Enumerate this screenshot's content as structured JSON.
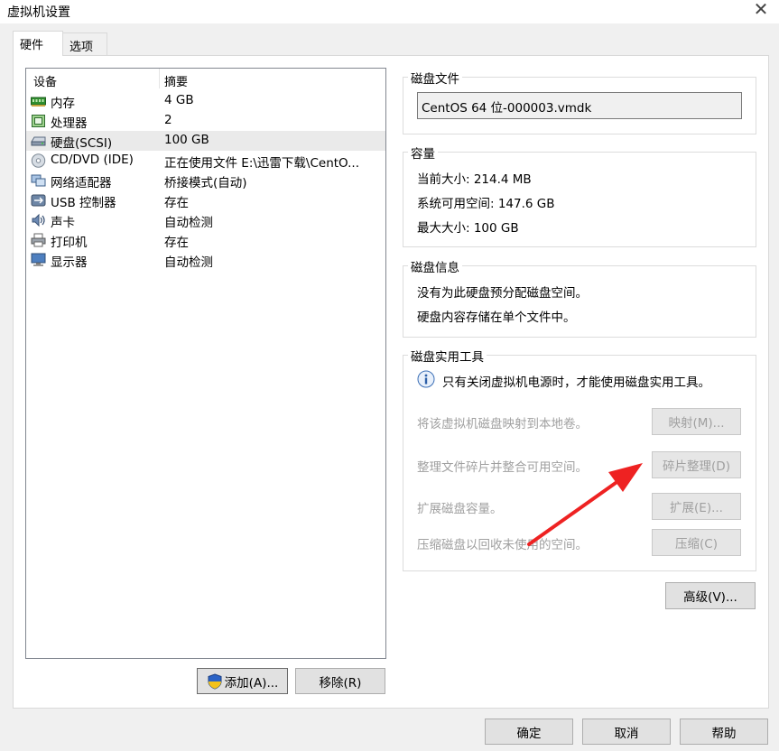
{
  "window": {
    "title": "虚拟机设置"
  },
  "tabs": [
    {
      "label": "硬件"
    },
    {
      "label": "选项"
    }
  ],
  "device_list": {
    "headers": {
      "device": "设备",
      "summary": "摘要"
    },
    "rows": [
      {
        "name": "内存",
        "summary": "4 GB",
        "icon": "memory-icon"
      },
      {
        "name": "处理器",
        "summary": "2",
        "icon": "processor-icon"
      },
      {
        "name": "硬盘(SCSI)",
        "summary": "100 GB",
        "icon": "hard-disk-icon"
      },
      {
        "name": "CD/DVD (IDE)",
        "summary": "正在使用文件 E:\\迅雷下载\\CentO...",
        "icon": "cd-dvd-icon"
      },
      {
        "name": "网络适配器",
        "summary": "桥接模式(自动)",
        "icon": "network-adapter-icon"
      },
      {
        "name": "USB 控制器",
        "summary": "存在",
        "icon": "usb-icon"
      },
      {
        "name": "声卡",
        "summary": "自动检测",
        "icon": "sound-card-icon"
      },
      {
        "name": "打印机",
        "summary": "存在",
        "icon": "printer-icon"
      },
      {
        "name": "显示器",
        "summary": "自动检测",
        "icon": "display-icon"
      }
    ],
    "selected_index": 2
  },
  "buttons": {
    "add": "添加(A)...",
    "remove": "移除(R)",
    "ok": "确定",
    "cancel": "取消",
    "help": "帮助",
    "advanced": "高级(V)..."
  },
  "disk_file": {
    "title": "磁盘文件",
    "value": "CentOS 64 位-000003.vmdk"
  },
  "capacity": {
    "title": "容量",
    "current_size": "当前大小: 214.4 MB",
    "free_space": "系统可用空间: 147.6 GB",
    "max_size": "最大大小: 100 GB"
  },
  "disk_info": {
    "title": "磁盘信息",
    "line1": "没有为此硬盘预分配磁盘空间。",
    "line2": "硬盘内容存储在单个文件中。"
  },
  "disk_utilities": {
    "title": "磁盘实用工具",
    "notice": "只有关闭虚拟机电源时，才能使用磁盘实用工具。",
    "items": [
      {
        "desc": "将该虚拟机磁盘映射到本地卷。",
        "button": "映射(M)..."
      },
      {
        "desc": "整理文件碎片并整合可用空间。",
        "button": "碎片整理(D)"
      },
      {
        "desc": "扩展磁盘容量。",
        "button": "扩展(E)..."
      },
      {
        "desc": "压缩磁盘以回收未使用的空间。",
        "button": "压缩(C)"
      }
    ]
  },
  "colors": {
    "arrow": "#ee2222",
    "selected_row": "#eaeaea",
    "disabled_text": "#a0a0a0"
  }
}
